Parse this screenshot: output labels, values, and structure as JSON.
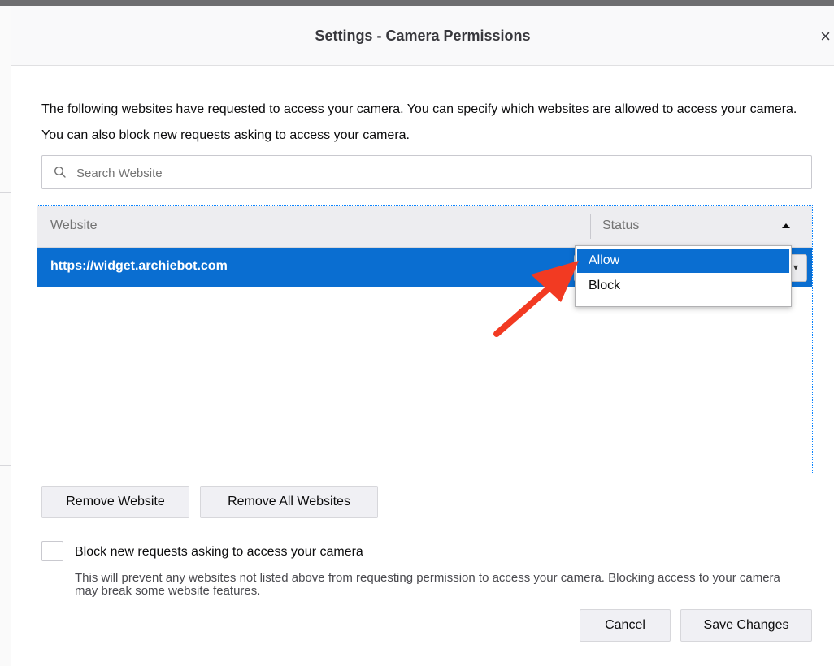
{
  "dialog": {
    "title": "Settings - Camera Permissions",
    "close_glyph": "×",
    "description": "The following websites have requested to access your camera. You can specify which websites are allowed to access your camera. You can also block new requests asking to access your camera."
  },
  "search": {
    "placeholder": "Search Website",
    "value": "",
    "icon": "search-icon"
  },
  "table": {
    "headers": {
      "website": "Website",
      "status": "Status"
    },
    "rows": [
      {
        "website": "https://widget.archiebot.com",
        "status": "Allow"
      }
    ]
  },
  "status_dropdown": {
    "options": [
      "Allow",
      "Block"
    ],
    "highlighted": "Allow"
  },
  "buttons": {
    "remove_website": "Remove Website",
    "remove_all": "Remove All Websites",
    "cancel": "Cancel",
    "save": "Save Changes"
  },
  "block_new": {
    "label": "Block new requests asking to access your camera",
    "help": "This will prevent any websites not listed above from requesting permission to access your camera. Blocking access to your camera may break some website features.",
    "checked": false
  },
  "colors": {
    "selected_row": "#0a6ed1",
    "annotation_arrow": "#f23a22",
    "focus_border": "#0a84ff"
  }
}
